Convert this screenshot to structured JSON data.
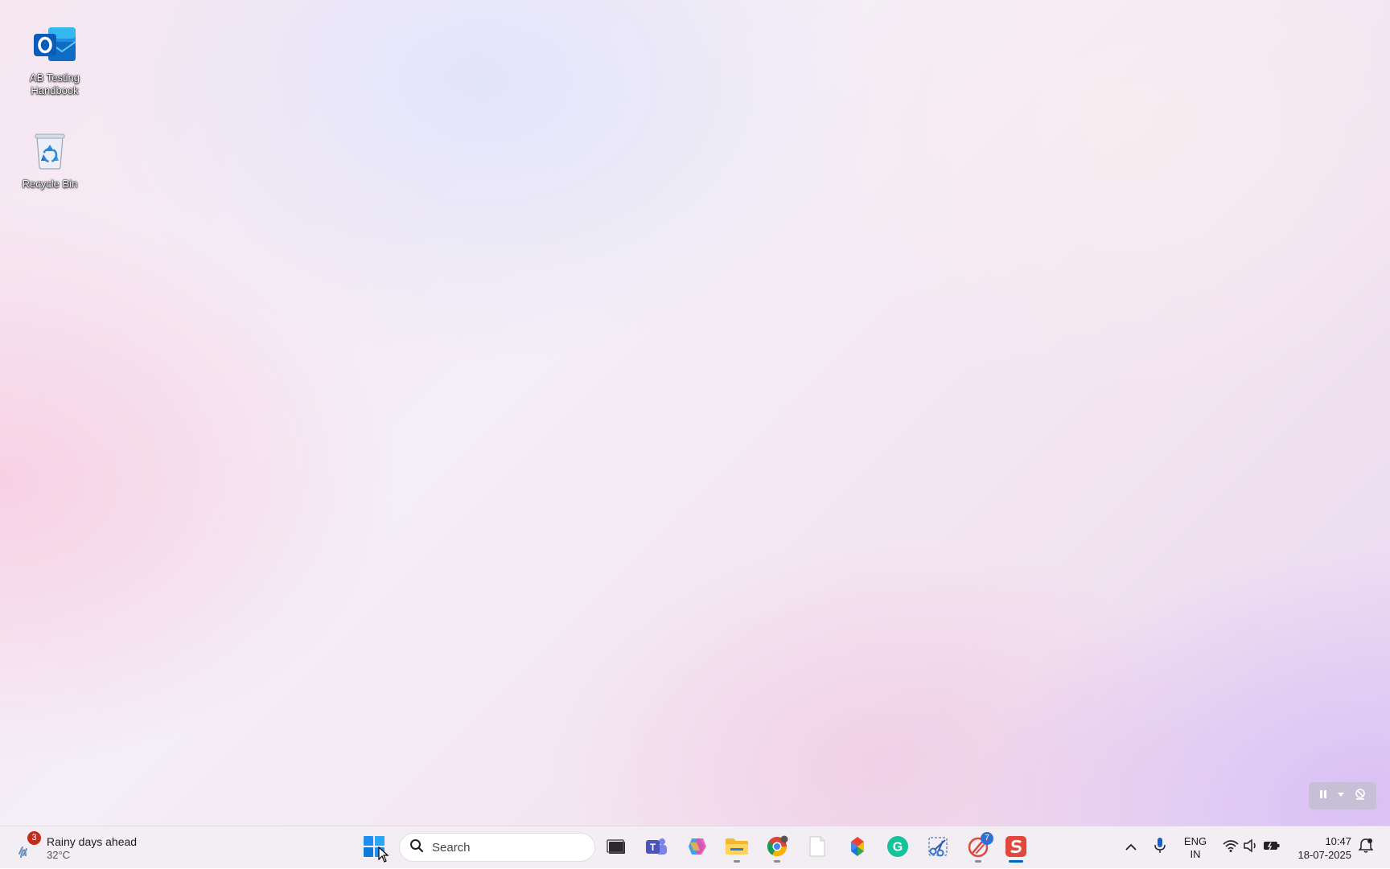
{
  "desktop": {
    "icons": [
      {
        "label": "AB Testing Handbook",
        "icon": "outlook-icon"
      },
      {
        "label": "Recycle Bin",
        "icon": "recycle-bin-icon"
      }
    ]
  },
  "taskbar": {
    "weather": {
      "badge": "3",
      "title": "Rainy days ahead",
      "temp": "32°C"
    },
    "search": {
      "label": "Search"
    },
    "apps": [
      {
        "name": "task-view",
        "icon": "task-view-icon"
      },
      {
        "name": "teams",
        "icon": "teams-icon"
      },
      {
        "name": "copilot",
        "icon": "copilot-icon"
      },
      {
        "name": "file-explorer",
        "icon": "folder-icon"
      },
      {
        "name": "chrome",
        "icon": "chrome-icon"
      },
      {
        "name": "notepad",
        "icon": "blank-document-icon"
      },
      {
        "name": "photos",
        "icon": "photos-icon"
      },
      {
        "name": "grammarly",
        "icon": "grammarly-icon"
      },
      {
        "name": "snipping-tool",
        "icon": "scissors-icon"
      },
      {
        "name": "app-with-badge",
        "icon": "gauge-icon",
        "badge": "7"
      },
      {
        "name": "wps",
        "icon": "wps-icon"
      }
    ],
    "tray": {
      "lang_line1": "ENG",
      "lang_line2": "IN",
      "time": "10:47",
      "date": "18-07-2025"
    }
  },
  "colors": {
    "accent": "#0067c0",
    "badge_red": "#c42b1c",
    "outlook_blue": "#0a64c8",
    "wps_red": "#e2473c",
    "grammarly_green": "#15c39a"
  }
}
